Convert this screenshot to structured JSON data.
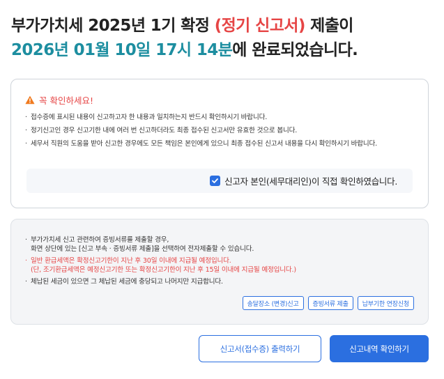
{
  "title": {
    "line1_prefix": "부가가치세 ",
    "line1_bold": "2025년 1기 확정 ",
    "line1_red": "(정기 신고서)",
    "line1_suffix": " 제출이",
    "line2_teal": "2026년 01월 10일 17시 14분",
    "line2_mid": "에 ",
    "line2_bold": "완료",
    "line2_suffix": "되었습니다."
  },
  "notice": {
    "heading": "꼭 확인하세요!",
    "items": [
      "접수증에 표시된 내용이 신고하고자 한 내용과 일치하는지 반드시 확인하시기 바랍니다.",
      "정기신고인 경우 신고기한 내에 여러 번 신고하더라도 최종 접수된 신고서만 유효한 것으로 봅니다.",
      "세무서 직원의 도움을 받아 신고한 경우에도 모든 책임은 본인에게 있으니 최종 접수된 신고서 내용을 다시 확인하시기 바랍니다."
    ],
    "confirm_label": "신고자 본인(세무대리인)이 직접 확인하였습니다."
  },
  "info": {
    "item1_line1": "부가가치세 신고 관련하여 증빙서류를 제출할 경우,",
    "item1_line2": "화면 상단에 있는 [신고 부속 · 증빙서류 제출]을 선택하여 전자제출할 수 있습니다.",
    "item2_line1": "일반 환급세액은 확정신고기한이 지난 후 30일 이내에 지급될 예정입니다.",
    "item2_line2": "(단, 조기환급세액은 예정신고기한 또는 확정신고기한이 지난 후 15일 이내에 지급될 예정입니다.)",
    "item3": "체납된 세금이 있으면 그 체납된 세금에 충당되고 나머지만 지급합니다.",
    "buttons": {
      "delivery_change": "송달장소 (변경)신고",
      "evidence_submit": "증빙서류 제출",
      "extension_request": "납부기한 연장신청"
    }
  },
  "actions": {
    "print_receipt": "신고서(접수증) 출력하기",
    "view_history": "신고내역 확인하기"
  },
  "colors": {
    "accent": "#2b6fe0",
    "red": "#e64545",
    "teal": "#1d8ea0"
  }
}
